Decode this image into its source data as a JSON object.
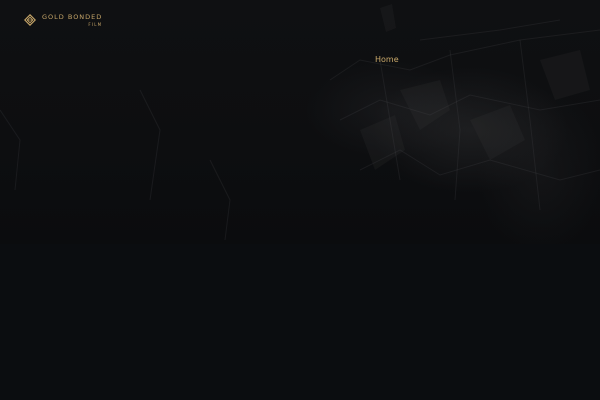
{
  "brand": {
    "name": "GOLD BONDED",
    "subtitle": "FILM",
    "logo_icon": "diamond-logo-icon",
    "accent_color": "#c9a86a"
  },
  "nav": {
    "items": [
      {
        "label": "Home"
      }
    ]
  },
  "colors": {
    "background": "#0b0d10",
    "hero_overlay": "#0f1012"
  }
}
